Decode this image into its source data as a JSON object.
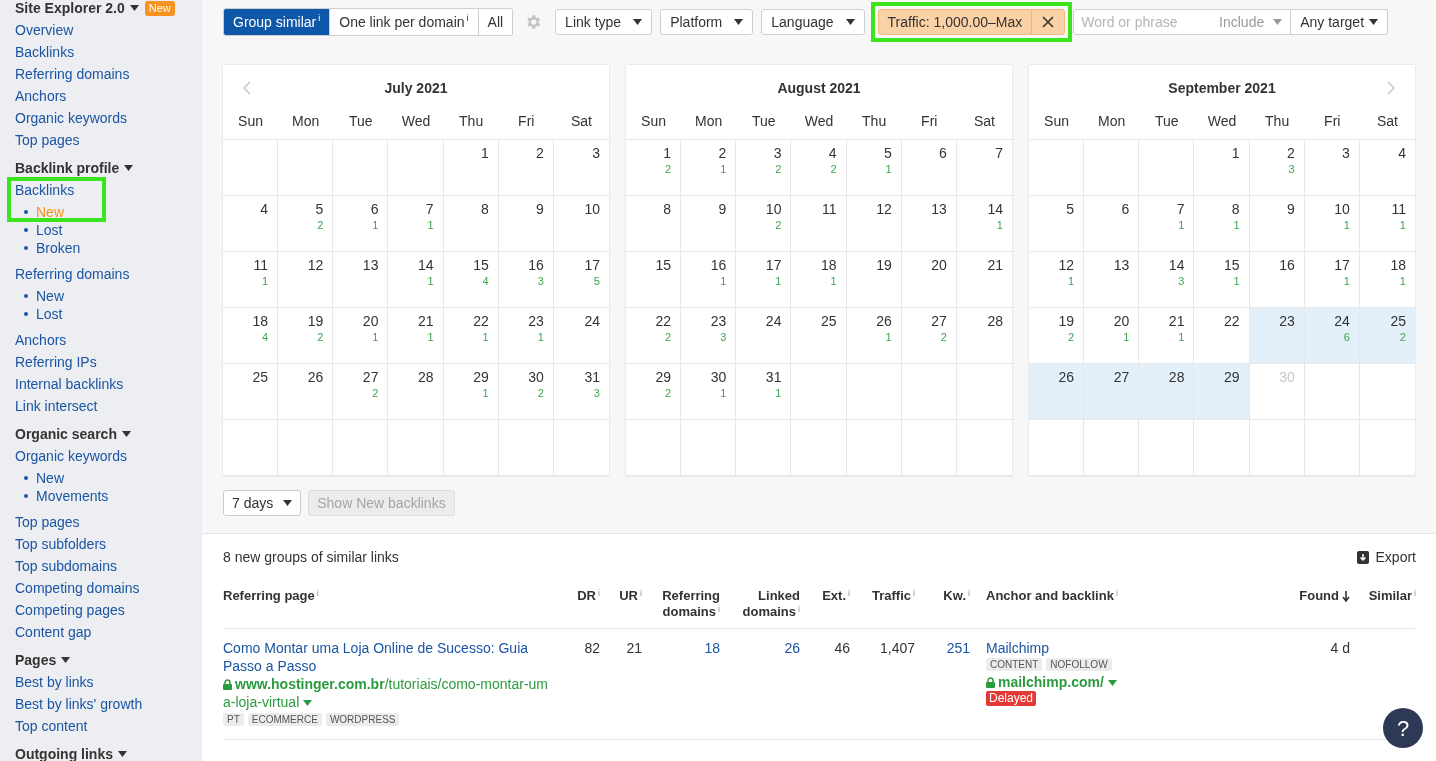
{
  "sidebar": {
    "sections": [
      {
        "title": "Site Explorer 2.0",
        "badge": "New",
        "items": [
          {
            "label": "Overview",
            "selected": false,
            "highlighted": false
          },
          {
            "label": "Backlinks",
            "selected": false,
            "highlighted": false
          },
          {
            "label": "Referring domains",
            "selected": false,
            "highlighted": false
          },
          {
            "label": "Anchors",
            "selected": false,
            "highlighted": false
          },
          {
            "label": "Organic keywords",
            "selected": false,
            "highlighted": false
          },
          {
            "label": "Top pages",
            "selected": false,
            "highlighted": false
          }
        ]
      },
      {
        "title": "Backlink profile",
        "items": [
          {
            "label": "Backlinks",
            "selected": false,
            "highlighted": true,
            "children": [
              {
                "label": "New",
                "selected": true
              },
              {
                "label": "Lost",
                "selected": false
              },
              {
                "label": "Broken",
                "selected": false
              }
            ]
          },
          {
            "label": "Referring domains",
            "selected": false,
            "highlighted": false,
            "children": [
              {
                "label": "New",
                "selected": false
              },
              {
                "label": "Lost",
                "selected": false
              }
            ]
          },
          {
            "label": "Anchors",
            "selected": false,
            "highlighted": false
          },
          {
            "label": "Referring IPs",
            "selected": false,
            "highlighted": false
          },
          {
            "label": "Internal backlinks",
            "selected": false,
            "highlighted": false
          },
          {
            "label": "Link intersect",
            "selected": false,
            "highlighted": false
          }
        ]
      },
      {
        "title": "Organic search",
        "items": [
          {
            "label": "Organic keywords",
            "selected": false,
            "highlighted": false,
            "children": [
              {
                "label": "New",
                "selected": false
              },
              {
                "label": "Movements",
                "selected": false
              }
            ]
          },
          {
            "label": "Top pages",
            "selected": false,
            "highlighted": false
          },
          {
            "label": "Top subfolders",
            "selected": false,
            "highlighted": false
          },
          {
            "label": "Top subdomains",
            "selected": false,
            "highlighted": false
          },
          {
            "label": "Competing domains",
            "selected": false,
            "highlighted": false
          },
          {
            "label": "Competing pages",
            "selected": false,
            "highlighted": false
          },
          {
            "label": "Content gap",
            "selected": false,
            "highlighted": false
          }
        ]
      },
      {
        "title": "Pages",
        "items": [
          {
            "label": "Best by links",
            "selected": false,
            "highlighted": false
          },
          {
            "label": "Best by links' growth",
            "selected": false,
            "highlighted": false
          },
          {
            "label": "Top content",
            "selected": false,
            "highlighted": false
          }
        ]
      },
      {
        "title": "Outgoing links"
      }
    ]
  },
  "toolbar": {
    "modes": [
      {
        "label": "Group similar",
        "hint": "i",
        "selected": true
      },
      {
        "label": "One link per domain",
        "hint": "i",
        "selected": false
      },
      {
        "label": "All",
        "selected": false
      }
    ],
    "filters": [
      {
        "kind": "dropdown",
        "label": "Link type"
      },
      {
        "kind": "dropdown",
        "label": "Platform"
      },
      {
        "kind": "dropdown",
        "label": "Language"
      },
      {
        "kind": "active",
        "label": "Traffic: 1,000.00–Max",
        "highlighted": true
      }
    ],
    "search": {
      "placeholder": "Word or phrase",
      "mode": "Include"
    },
    "target": "Any target"
  },
  "calendars": [
    {
      "title": "July 2021",
      "prev": true,
      "next": false,
      "weekdays": [
        "Sun",
        "Mon",
        "Tue",
        "Wed",
        "Thu",
        "Fri",
        "Sat"
      ],
      "weeks": [
        [
          {
            "kind": "blank"
          },
          {
            "kind": "blank"
          },
          {
            "kind": "blank"
          },
          {
            "kind": "blank"
          },
          {
            "kind": "day",
            "day": "1",
            "selected": false,
            "disabled": false
          },
          {
            "kind": "day",
            "day": "2",
            "selected": false,
            "disabled": false
          },
          {
            "kind": "day",
            "day": "3",
            "selected": false,
            "disabled": false
          }
        ],
        [
          {
            "kind": "day",
            "day": "4",
            "selected": false,
            "disabled": false
          },
          {
            "kind": "day",
            "day": "5",
            "count": "2",
            "selected": false,
            "disabled": false
          },
          {
            "kind": "day",
            "day": "6",
            "count": "1",
            "selected": false,
            "disabled": false
          },
          {
            "kind": "day",
            "day": "7",
            "count": "1",
            "selected": false,
            "disabled": false
          },
          {
            "kind": "day",
            "day": "8",
            "selected": false,
            "disabled": false
          },
          {
            "kind": "day",
            "day": "9",
            "selected": false,
            "disabled": false
          },
          {
            "kind": "day",
            "day": "10",
            "selected": false,
            "disabled": false
          }
        ],
        [
          {
            "kind": "day",
            "day": "11",
            "count": "1",
            "selected": false,
            "disabled": false
          },
          {
            "kind": "day",
            "day": "12",
            "selected": false,
            "disabled": false
          },
          {
            "kind": "day",
            "day": "13",
            "selected": false,
            "disabled": false
          },
          {
            "kind": "day",
            "day": "14",
            "count": "1",
            "selected": false,
            "disabled": false
          },
          {
            "kind": "day",
            "day": "15",
            "count": "4",
            "selected": false,
            "disabled": false
          },
          {
            "kind": "day",
            "day": "16",
            "count": "3",
            "selected": false,
            "disabled": false
          },
          {
            "kind": "day",
            "day": "17",
            "count": "5",
            "selected": false,
            "disabled": false
          }
        ],
        [
          {
            "kind": "day",
            "day": "18",
            "count": "4",
            "selected": false,
            "disabled": false
          },
          {
            "kind": "day",
            "day": "19",
            "count": "2",
            "selected": false,
            "disabled": false
          },
          {
            "kind": "day",
            "day": "20",
            "count": "1",
            "selected": false,
            "disabled": false
          },
          {
            "kind": "day",
            "day": "21",
            "count": "1",
            "selected": false,
            "disabled": false
          },
          {
            "kind": "day",
            "day": "22",
            "count": "1",
            "selected": false,
            "disabled": false
          },
          {
            "kind": "day",
            "day": "23",
            "count": "1",
            "selected": false,
            "disabled": false
          },
          {
            "kind": "day",
            "day": "24",
            "selected": false,
            "disabled": false
          }
        ],
        [
          {
            "kind": "day",
            "day": "25",
            "selected": false,
            "disabled": false
          },
          {
            "kind": "day",
            "day": "26",
            "selected": false,
            "disabled": false
          },
          {
            "kind": "day",
            "day": "27",
            "count": "2",
            "selected": false,
            "disabled": false
          },
          {
            "kind": "day",
            "day": "28",
            "selected": false,
            "disabled": false
          },
          {
            "kind": "day",
            "day": "29",
            "count": "1",
            "selected": false,
            "disabled": false
          },
          {
            "kind": "day",
            "day": "30",
            "count": "2",
            "selected": false,
            "disabled": false
          },
          {
            "kind": "day",
            "day": "31",
            "count": "3",
            "selected": false,
            "disabled": false
          }
        ],
        [
          {
            "kind": "blank"
          },
          {
            "kind": "blank"
          },
          {
            "kind": "blank"
          },
          {
            "kind": "blank"
          },
          {
            "kind": "blank"
          },
          {
            "kind": "blank"
          },
          {
            "kind": "blank"
          }
        ]
      ]
    },
    {
      "title": "August 2021",
      "prev": false,
      "next": false,
      "weekdays": [
        "Sun",
        "Mon",
        "Tue",
        "Wed",
        "Thu",
        "Fri",
        "Sat"
      ],
      "weeks": [
        [
          {
            "kind": "day",
            "day": "1",
            "count": "2",
            "selected": false,
            "disabled": false
          },
          {
            "kind": "day",
            "day": "2",
            "count": "1",
            "selected": false,
            "disabled": false
          },
          {
            "kind": "day",
            "day": "3",
            "count": "2",
            "selected": false,
            "disabled": false
          },
          {
            "kind": "day",
            "day": "4",
            "count": "2",
            "selected": false,
            "disabled": false
          },
          {
            "kind": "day",
            "day": "5",
            "count": "1",
            "selected": false,
            "disabled": false
          },
          {
            "kind": "day",
            "day": "6",
            "selected": false,
            "disabled": false
          },
          {
            "kind": "day",
            "day": "7",
            "selected": false,
            "disabled": false
          }
        ],
        [
          {
            "kind": "day",
            "day": "8",
            "selected": false,
            "disabled": false
          },
          {
            "kind": "day",
            "day": "9",
            "selected": false,
            "disabled": false
          },
          {
            "kind": "day",
            "day": "10",
            "count": "2",
            "selected": false,
            "disabled": false
          },
          {
            "kind": "day",
            "day": "11",
            "selected": false,
            "disabled": false
          },
          {
            "kind": "day",
            "day": "12",
            "selected": false,
            "disabled": false
          },
          {
            "kind": "day",
            "day": "13",
            "selected": false,
            "disabled": false
          },
          {
            "kind": "day",
            "day": "14",
            "count": "1",
            "selected": false,
            "disabled": false
          }
        ],
        [
          {
            "kind": "day",
            "day": "15",
            "selected": false,
            "disabled": false
          },
          {
            "kind": "day",
            "day": "16",
            "count": "1",
            "selected": false,
            "disabled": false
          },
          {
            "kind": "day",
            "day": "17",
            "count": "1",
            "selected": false,
            "disabled": false
          },
          {
            "kind": "day",
            "day": "18",
            "count": "1",
            "selected": false,
            "disabled": false
          },
          {
            "kind": "day",
            "day": "19",
            "selected": false,
            "disabled": false
          },
          {
            "kind": "day",
            "day": "20",
            "selected": false,
            "disabled": false
          },
          {
            "kind": "day",
            "day": "21",
            "selected": false,
            "disabled": false
          }
        ],
        [
          {
            "kind": "day",
            "day": "22",
            "count": "2",
            "selected": false,
            "disabled": false
          },
          {
            "kind": "day",
            "day": "23",
            "count": "3",
            "selected": false,
            "disabled": false
          },
          {
            "kind": "day",
            "day": "24",
            "selected": false,
            "disabled": false
          },
          {
            "kind": "day",
            "day": "25",
            "selected": false,
            "disabled": false
          },
          {
            "kind": "day",
            "day": "26",
            "count": "1",
            "selected": false,
            "disabled": false
          },
          {
            "kind": "day",
            "day": "27",
            "count": "2",
            "selected": false,
            "disabled": false
          },
          {
            "kind": "day",
            "day": "28",
            "selected": false,
            "disabled": false
          }
        ],
        [
          {
            "kind": "day",
            "day": "29",
            "count": "2",
            "selected": false,
            "disabled": false
          },
          {
            "kind": "day",
            "day": "30",
            "count": "1",
            "selected": false,
            "disabled": false
          },
          {
            "kind": "day",
            "day": "31",
            "count": "1",
            "selected": false,
            "disabled": false
          },
          {
            "kind": "blank"
          },
          {
            "kind": "blank"
          },
          {
            "kind": "blank"
          },
          {
            "kind": "blank"
          }
        ],
        [
          {
            "kind": "blank"
          },
          {
            "kind": "blank"
          },
          {
            "kind": "blank"
          },
          {
            "kind": "blank"
          },
          {
            "kind": "blank"
          },
          {
            "kind": "blank"
          },
          {
            "kind": "blank"
          }
        ]
      ]
    },
    {
      "title": "September 2021",
      "prev": false,
      "next": true,
      "weekdays": [
        "Sun",
        "Mon",
        "Tue",
        "Wed",
        "Thu",
        "Fri",
        "Sat"
      ],
      "weeks": [
        [
          {
            "kind": "blank"
          },
          {
            "kind": "blank"
          },
          {
            "kind": "blank"
          },
          {
            "kind": "day",
            "day": "1",
            "selected": false,
            "disabled": false
          },
          {
            "kind": "day",
            "day": "2",
            "count": "3",
            "selected": false,
            "disabled": false
          },
          {
            "kind": "day",
            "day": "3",
            "selected": false,
            "disabled": false
          },
          {
            "kind": "day",
            "day": "4",
            "selected": false,
            "disabled": false
          }
        ],
        [
          {
            "kind": "day",
            "day": "5",
            "selected": false,
            "disabled": false
          },
          {
            "kind": "day",
            "day": "6",
            "selected": false,
            "disabled": false
          },
          {
            "kind": "day",
            "day": "7",
            "count": "1",
            "selected": false,
            "disabled": false
          },
          {
            "kind": "day",
            "day": "8",
            "count": "1",
            "selected": false,
            "disabled": false
          },
          {
            "kind": "day",
            "day": "9",
            "selected": false,
            "disabled": false
          },
          {
            "kind": "day",
            "day": "10",
            "count": "1",
            "selected": false,
            "disabled": false
          },
          {
            "kind": "day",
            "day": "11",
            "count": "1",
            "selected": false,
            "disabled": false
          }
        ],
        [
          {
            "kind": "day",
            "day": "12",
            "count": "1",
            "selected": false,
            "disabled": false
          },
          {
            "kind": "day",
            "day": "13",
            "selected": false,
            "disabled": false
          },
          {
            "kind": "day",
            "day": "14",
            "count": "3",
            "selected": false,
            "disabled": false
          },
          {
            "kind": "day",
            "day": "15",
            "count": "1",
            "selected": false,
            "disabled": false
          },
          {
            "kind": "day",
            "day": "16",
            "selected": false,
            "disabled": false
          },
          {
            "kind": "day",
            "day": "17",
            "count": "1",
            "selected": false,
            "disabled": false
          },
          {
            "kind": "day",
            "day": "18",
            "count": "1",
            "selected": false,
            "disabled": false
          }
        ],
        [
          {
            "kind": "day",
            "day": "19",
            "count": "2",
            "selected": false,
            "disabled": false
          },
          {
            "kind": "day",
            "day": "20",
            "count": "1",
            "selected": false,
            "disabled": false
          },
          {
            "kind": "day",
            "day": "21",
            "count": "1",
            "selected": false,
            "disabled": false
          },
          {
            "kind": "day",
            "day": "22",
            "selected": false,
            "disabled": false
          },
          {
            "kind": "day",
            "day": "23",
            "selected": true,
            "disabled": false
          },
          {
            "kind": "day",
            "day": "24",
            "count": "6",
            "selected": true,
            "disabled": false
          },
          {
            "kind": "day",
            "day": "25",
            "count": "2",
            "selected": true,
            "disabled": false
          }
        ],
        [
          {
            "kind": "day",
            "day": "26",
            "selected": true,
            "disabled": false
          },
          {
            "kind": "day",
            "day": "27",
            "selected": true,
            "disabled": false
          },
          {
            "kind": "day",
            "day": "28",
            "selected": true,
            "disabled": false
          },
          {
            "kind": "day",
            "day": "29",
            "selected": true,
            "disabled": false
          },
          {
            "kind": "day",
            "day": "30",
            "selected": false,
            "disabled": true
          },
          {
            "kind": "blank"
          },
          {
            "kind": "blank"
          }
        ],
        [
          {
            "kind": "blank"
          },
          {
            "kind": "blank"
          },
          {
            "kind": "blank"
          },
          {
            "kind": "blank"
          },
          {
            "kind": "blank"
          },
          {
            "kind": "blank"
          },
          {
            "kind": "blank"
          }
        ]
      ]
    }
  ],
  "period": {
    "label": "7 days",
    "action": "Show New backlinks",
    "action_disabled": true
  },
  "results": {
    "summary": "8 new groups of similar links",
    "export": "Export"
  },
  "table": {
    "columns": [
      {
        "label": "Referring page",
        "hint": "i",
        "sorted": false
      },
      {
        "label": "DR",
        "hint": "i",
        "sorted": false
      },
      {
        "label": "UR",
        "hint": "i",
        "sorted": false
      },
      {
        "label": "Referring domains",
        "hint": "i",
        "sorted": false
      },
      {
        "label": "Linked domains",
        "hint": "i",
        "sorted": false
      },
      {
        "label": "Ext.",
        "hint": "i",
        "sorted": false
      },
      {
        "label": "Traffic",
        "hint": "i",
        "sorted": false
      },
      {
        "label": "Kw.",
        "hint": "i",
        "sorted": false
      },
      {
        "label": "Anchor and backlink",
        "hint": "i",
        "sorted": false
      },
      {
        "label": "Found",
        "sorted": true
      },
      {
        "label": "Similar",
        "hint": "i",
        "sorted": false
      }
    ],
    "rows": [
      {
        "title": "Como Montar uma Loja Online de Sucesso: Guia Passo a Passo",
        "url": "**www.hostinger.com.br**/tutoriais/como-montar-uma-loja-virtual",
        "tags": [
          "PT",
          "ECOMMERCE",
          "WORDPRESS"
        ],
        "dr": "82",
        "ur": "21",
        "referring_domains": "18",
        "linked_domains": "26",
        "ext": "46",
        "traffic": "1,407",
        "kw": "251",
        "anchor": "Mailchimp",
        "anchor_tags": [
          "CONTENT",
          "NOFOLLOW"
        ],
        "target": "mailchimp.com/",
        "badge": "Delayed",
        "found": "4 d"
      }
    ]
  },
  "help": "?"
}
